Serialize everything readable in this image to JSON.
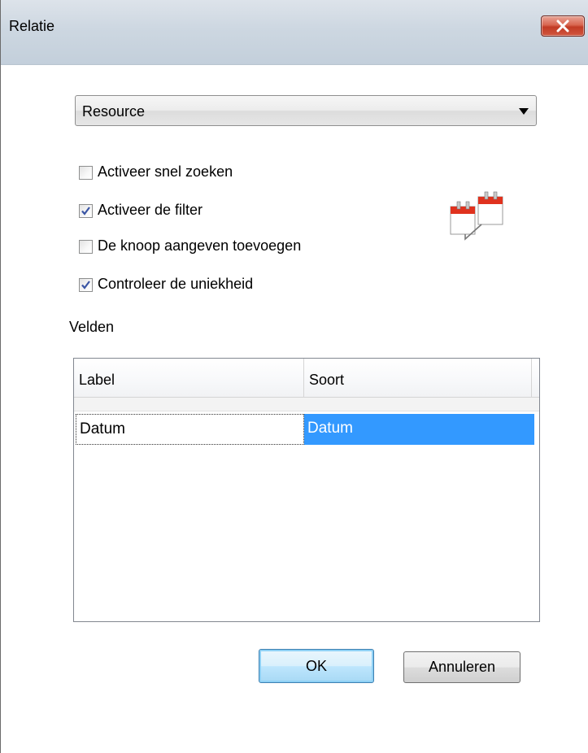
{
  "window": {
    "title": "Relatie"
  },
  "dropdown": {
    "selected": "Resource"
  },
  "options": [
    {
      "label": "Activeer snel zoeken",
      "checked": false
    },
    {
      "label": "Activeer de filter",
      "checked": true
    },
    {
      "label": "De knoop aangeven toevoegen",
      "checked": false
    },
    {
      "label": "Controleer de uniekheid",
      "checked": true
    }
  ],
  "fields": {
    "section_label": "Velden",
    "columns": [
      "Label",
      "Soort"
    ],
    "rows": [
      {
        "label": "Datum",
        "soort": "Datum"
      }
    ]
  },
  "buttons": {
    "ok": "OK",
    "cancel": "Annuleren"
  },
  "colors": {
    "selection": "#3399ff",
    "close_button": "#c13b25"
  },
  "icons": {
    "close": "close-icon",
    "calendar_relation": "calendar-link-icon",
    "dropdown": "chevron-down-icon",
    "checkmark": "checkmark-icon"
  }
}
